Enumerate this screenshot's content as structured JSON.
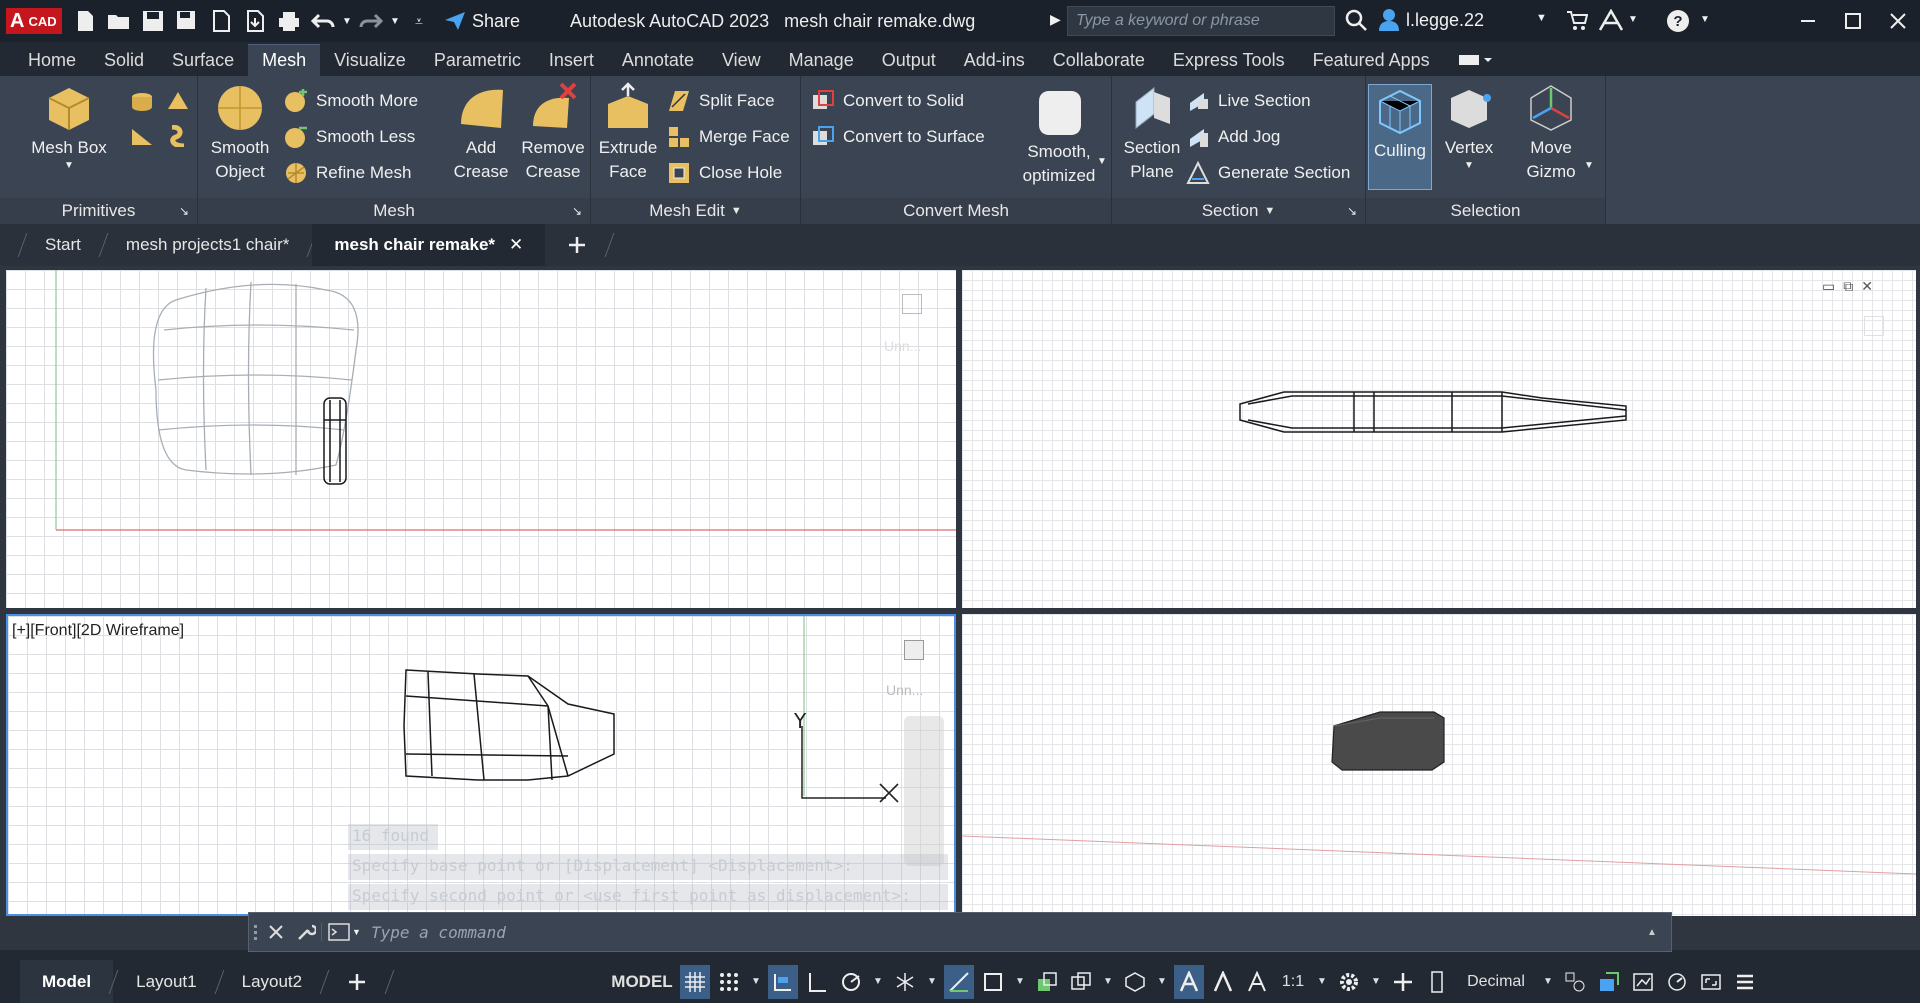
{
  "app": {
    "logo_text": "CAD",
    "logo_letter": "A",
    "title": "Autodesk AutoCAD 2023   mesh chair remake.dwg",
    "share_label": "Share",
    "search_placeholder": "Type a keyword or phrase",
    "user": "l.legge.22"
  },
  "ribbon_tabs": [
    "Home",
    "Solid",
    "Surface",
    "Mesh",
    "Visualize",
    "Parametric",
    "Insert",
    "Annotate",
    "View",
    "Manage",
    "Output",
    "Add-ins",
    "Collaborate",
    "Express Tools",
    "Featured Apps"
  ],
  "ribbon": {
    "primitives": {
      "label": "Primitives",
      "mesh_box": "Mesh Box"
    },
    "mesh": {
      "label": "Mesh",
      "smooth_object_1": "Smooth",
      "smooth_object_2": "Object",
      "smooth_more": "Smooth More",
      "smooth_less": "Smooth Less",
      "refine_mesh": "Refine Mesh",
      "add_crease_1": "Add",
      "add_crease_2": "Crease",
      "remove_crease_1": "Remove",
      "remove_crease_2": "Crease"
    },
    "mesh_edit": {
      "label": "Mesh Edit",
      "extrude_1": "Extrude",
      "extrude_2": "Face",
      "split_face": "Split Face",
      "merge_face": "Merge Face",
      "close_hole": "Close Hole"
    },
    "convert_mesh": {
      "label": "Convert Mesh",
      "convert_solid": "Convert to Solid",
      "convert_surface": "Convert to Surface",
      "smooth_opt_1": "Smooth,",
      "smooth_opt_2": "optimized"
    },
    "section": {
      "label": "Section",
      "plane_1": "Section",
      "plane_2": "Plane",
      "live_section": "Live Section",
      "add_jog": "Add Jog",
      "generate_section": "Generate Section"
    },
    "selection": {
      "label": "Selection",
      "culling": "Culling",
      "vertex": "Vertex",
      "move_1": "Move",
      "move_2": "Gizmo"
    }
  },
  "doc_tabs": [
    "Start",
    "mesh projects1 chair*",
    "mesh chair remake*"
  ],
  "viewports": {
    "front_label": "[+][Front][2D Wireframe]",
    "unnamed": "Unn...",
    "y_axis": "Y"
  },
  "command": {
    "placeholder": "Type a command",
    "history": [
      "16 found",
      "Specify base point or [Displacement] <Displacement>:",
      "Specify second point or <use first point as displacement>:"
    ]
  },
  "status_tabs": [
    "Model",
    "Layout1",
    "Layout2"
  ],
  "status": {
    "model": "MODEL",
    "scale": "1:1",
    "units": "Decimal"
  }
}
